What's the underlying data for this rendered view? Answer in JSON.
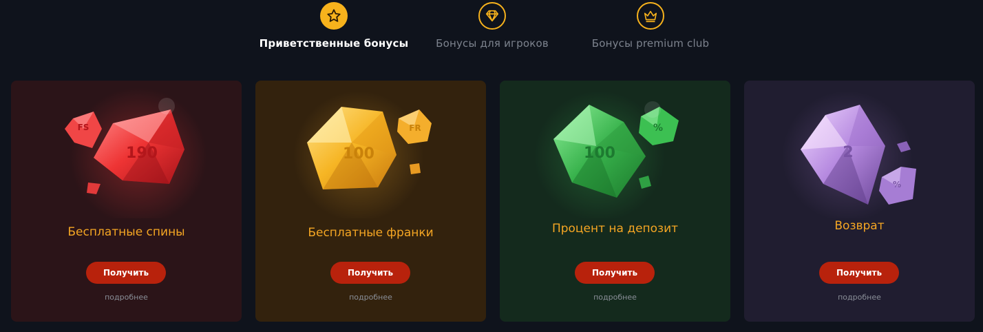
{
  "tabs": [
    {
      "label": "Приветственные бонусы",
      "icon": "star-icon",
      "active": true
    },
    {
      "label": "Бонусы для игроков",
      "icon": "diamond-icon",
      "active": false
    },
    {
      "label": "Бонусы premium club",
      "icon": "crown-icon",
      "active": false
    }
  ],
  "accent_color": "#f7b21c",
  "button_color": "#b8220c",
  "cards": [
    {
      "title": "Бесплатные спины",
      "gem_value": "190",
      "small_gem_label": "FS",
      "button_label": "Получить",
      "more_label": "подробнее",
      "background": "#2b1418",
      "gem_color": "#e8363a"
    },
    {
      "title": "Бесплатные франки",
      "gem_value": "100",
      "small_gem_label": "FR",
      "button_label": "Получить",
      "more_label": "подробнее",
      "background": "#33220d",
      "gem_color": "#f2b02e"
    },
    {
      "title": "Процент на депозит",
      "gem_value": "100",
      "small_gem_label": "%",
      "button_label": "Получить",
      "more_label": "подробнее",
      "background": "#142a1d",
      "gem_color": "#37b24d"
    },
    {
      "title": "Возврат",
      "gem_value": "2",
      "small_gem_label": "%",
      "button_label": "Получить",
      "more_label": "подробнее",
      "background": "#201d30",
      "gem_color": "#b48ad8"
    }
  ]
}
